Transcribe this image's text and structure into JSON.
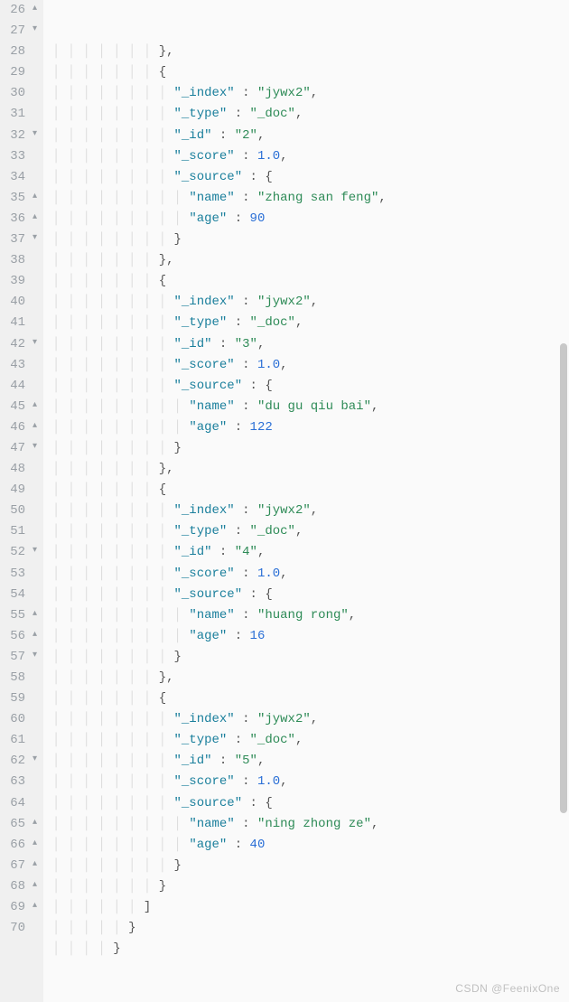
{
  "watermark": "CSDN @FeenixOne",
  "lines": [
    {
      "num": 26,
      "fold": "up",
      "indent": 7,
      "tokens": [
        [
          "p",
          "},"
        ]
      ]
    },
    {
      "num": 27,
      "fold": "down",
      "indent": 7,
      "tokens": [
        [
          "p",
          "{"
        ]
      ]
    },
    {
      "num": 28,
      "fold": "",
      "indent": 8,
      "tokens": [
        [
          "k",
          "\"_index\""
        ],
        [
          "p",
          " : "
        ],
        [
          "s",
          "\"jywx2\""
        ],
        [
          "p",
          ","
        ]
      ]
    },
    {
      "num": 29,
      "fold": "",
      "indent": 8,
      "tokens": [
        [
          "k",
          "\"_type\""
        ],
        [
          "p",
          " : "
        ],
        [
          "s",
          "\"_doc\""
        ],
        [
          "p",
          ","
        ]
      ]
    },
    {
      "num": 30,
      "fold": "",
      "indent": 8,
      "tokens": [
        [
          "k",
          "\"_id\""
        ],
        [
          "p",
          " : "
        ],
        [
          "s",
          "\"2\""
        ],
        [
          "p",
          ","
        ]
      ]
    },
    {
      "num": 31,
      "fold": "",
      "indent": 8,
      "tokens": [
        [
          "k",
          "\"_score\""
        ],
        [
          "p",
          " : "
        ],
        [
          "n",
          "1.0"
        ],
        [
          "p",
          ","
        ]
      ]
    },
    {
      "num": 32,
      "fold": "down",
      "indent": 8,
      "tokens": [
        [
          "k",
          "\"_source\""
        ],
        [
          "p",
          " : {"
        ]
      ]
    },
    {
      "num": 33,
      "fold": "",
      "indent": 9,
      "tokens": [
        [
          "k",
          "\"name\""
        ],
        [
          "p",
          " : "
        ],
        [
          "s",
          "\"zhang san feng\""
        ],
        [
          "p",
          ","
        ]
      ]
    },
    {
      "num": 34,
      "fold": "",
      "indent": 9,
      "tokens": [
        [
          "k",
          "\"age\""
        ],
        [
          "p",
          " : "
        ],
        [
          "n",
          "90"
        ]
      ]
    },
    {
      "num": 35,
      "fold": "up",
      "indent": 8,
      "tokens": [
        [
          "p",
          "}"
        ]
      ]
    },
    {
      "num": 36,
      "fold": "up",
      "indent": 7,
      "tokens": [
        [
          "p",
          "},"
        ]
      ]
    },
    {
      "num": 37,
      "fold": "down",
      "indent": 7,
      "tokens": [
        [
          "p",
          "{"
        ]
      ]
    },
    {
      "num": 38,
      "fold": "",
      "indent": 8,
      "tokens": [
        [
          "k",
          "\"_index\""
        ],
        [
          "p",
          " : "
        ],
        [
          "s",
          "\"jywx2\""
        ],
        [
          "p",
          ","
        ]
      ]
    },
    {
      "num": 39,
      "fold": "",
      "indent": 8,
      "tokens": [
        [
          "k",
          "\"_type\""
        ],
        [
          "p",
          " : "
        ],
        [
          "s",
          "\"_doc\""
        ],
        [
          "p",
          ","
        ]
      ]
    },
    {
      "num": 40,
      "fold": "",
      "indent": 8,
      "tokens": [
        [
          "k",
          "\"_id\""
        ],
        [
          "p",
          " : "
        ],
        [
          "s",
          "\"3\""
        ],
        [
          "p",
          ","
        ]
      ]
    },
    {
      "num": 41,
      "fold": "",
      "indent": 8,
      "tokens": [
        [
          "k",
          "\"_score\""
        ],
        [
          "p",
          " : "
        ],
        [
          "n",
          "1.0"
        ],
        [
          "p",
          ","
        ]
      ]
    },
    {
      "num": 42,
      "fold": "down",
      "indent": 8,
      "tokens": [
        [
          "k",
          "\"_source\""
        ],
        [
          "p",
          " : {"
        ]
      ]
    },
    {
      "num": 43,
      "fold": "",
      "indent": 9,
      "tokens": [
        [
          "k",
          "\"name\""
        ],
        [
          "p",
          " : "
        ],
        [
          "s",
          "\"du gu qiu bai\""
        ],
        [
          "p",
          ","
        ]
      ]
    },
    {
      "num": 44,
      "fold": "",
      "indent": 9,
      "tokens": [
        [
          "k",
          "\"age\""
        ],
        [
          "p",
          " : "
        ],
        [
          "n",
          "122"
        ]
      ]
    },
    {
      "num": 45,
      "fold": "up",
      "indent": 8,
      "tokens": [
        [
          "p",
          "}"
        ]
      ]
    },
    {
      "num": 46,
      "fold": "up",
      "indent": 7,
      "tokens": [
        [
          "p",
          "},"
        ]
      ]
    },
    {
      "num": 47,
      "fold": "down",
      "indent": 7,
      "tokens": [
        [
          "p",
          "{"
        ]
      ]
    },
    {
      "num": 48,
      "fold": "",
      "indent": 8,
      "tokens": [
        [
          "k",
          "\"_index\""
        ],
        [
          "p",
          " : "
        ],
        [
          "s",
          "\"jywx2\""
        ],
        [
          "p",
          ","
        ]
      ]
    },
    {
      "num": 49,
      "fold": "",
      "indent": 8,
      "tokens": [
        [
          "k",
          "\"_type\""
        ],
        [
          "p",
          " : "
        ],
        [
          "s",
          "\"_doc\""
        ],
        [
          "p",
          ","
        ]
      ]
    },
    {
      "num": 50,
      "fold": "",
      "indent": 8,
      "tokens": [
        [
          "k",
          "\"_id\""
        ],
        [
          "p",
          " : "
        ],
        [
          "s",
          "\"4\""
        ],
        [
          "p",
          ","
        ]
      ]
    },
    {
      "num": 51,
      "fold": "",
      "indent": 8,
      "tokens": [
        [
          "k",
          "\"_score\""
        ],
        [
          "p",
          " : "
        ],
        [
          "n",
          "1.0"
        ],
        [
          "p",
          ","
        ]
      ]
    },
    {
      "num": 52,
      "fold": "down",
      "indent": 8,
      "tokens": [
        [
          "k",
          "\"_source\""
        ],
        [
          "p",
          " : {"
        ]
      ]
    },
    {
      "num": 53,
      "fold": "",
      "indent": 9,
      "tokens": [
        [
          "k",
          "\"name\""
        ],
        [
          "p",
          " : "
        ],
        [
          "s",
          "\"huang rong\""
        ],
        [
          "p",
          ","
        ]
      ]
    },
    {
      "num": 54,
      "fold": "",
      "indent": 9,
      "tokens": [
        [
          "k",
          "\"age\""
        ],
        [
          "p",
          " : "
        ],
        [
          "n",
          "16"
        ]
      ]
    },
    {
      "num": 55,
      "fold": "up",
      "indent": 8,
      "tokens": [
        [
          "p",
          "}"
        ]
      ]
    },
    {
      "num": 56,
      "fold": "up",
      "indent": 7,
      "tokens": [
        [
          "p",
          "},"
        ]
      ]
    },
    {
      "num": 57,
      "fold": "down",
      "indent": 7,
      "tokens": [
        [
          "p",
          "{"
        ]
      ]
    },
    {
      "num": 58,
      "fold": "",
      "indent": 8,
      "tokens": [
        [
          "k",
          "\"_index\""
        ],
        [
          "p",
          " : "
        ],
        [
          "s",
          "\"jywx2\""
        ],
        [
          "p",
          ","
        ]
      ]
    },
    {
      "num": 59,
      "fold": "",
      "indent": 8,
      "tokens": [
        [
          "k",
          "\"_type\""
        ],
        [
          "p",
          " : "
        ],
        [
          "s",
          "\"_doc\""
        ],
        [
          "p",
          ","
        ]
      ]
    },
    {
      "num": 60,
      "fold": "",
      "indent": 8,
      "tokens": [
        [
          "k",
          "\"_id\""
        ],
        [
          "p",
          " : "
        ],
        [
          "s",
          "\"5\""
        ],
        [
          "p",
          ","
        ]
      ]
    },
    {
      "num": 61,
      "fold": "",
      "indent": 8,
      "tokens": [
        [
          "k",
          "\"_score\""
        ],
        [
          "p",
          " : "
        ],
        [
          "n",
          "1.0"
        ],
        [
          "p",
          ","
        ]
      ]
    },
    {
      "num": 62,
      "fold": "down",
      "indent": 8,
      "tokens": [
        [
          "k",
          "\"_source\""
        ],
        [
          "p",
          " : {"
        ]
      ]
    },
    {
      "num": 63,
      "fold": "",
      "indent": 9,
      "tokens": [
        [
          "k",
          "\"name\""
        ],
        [
          "p",
          " : "
        ],
        [
          "s",
          "\"ning zhong ze\""
        ],
        [
          "p",
          ","
        ]
      ]
    },
    {
      "num": 64,
      "fold": "",
      "indent": 9,
      "tokens": [
        [
          "k",
          "\"age\""
        ],
        [
          "p",
          " : "
        ],
        [
          "n",
          "40"
        ]
      ]
    },
    {
      "num": 65,
      "fold": "up",
      "indent": 8,
      "tokens": [
        [
          "p",
          "}"
        ]
      ]
    },
    {
      "num": 66,
      "fold": "up",
      "indent": 7,
      "tokens": [
        [
          "p",
          "}"
        ]
      ]
    },
    {
      "num": 67,
      "fold": "up",
      "indent": 6,
      "tokens": [
        [
          "p",
          "]"
        ]
      ]
    },
    {
      "num": 68,
      "fold": "up",
      "indent": 5,
      "tokens": [
        [
          "p",
          "}"
        ]
      ]
    },
    {
      "num": 69,
      "fold": "up",
      "indent": 4,
      "tokens": [
        [
          "p",
          "}"
        ]
      ]
    },
    {
      "num": 70,
      "fold": "",
      "indent": 0,
      "tokens": []
    }
  ]
}
